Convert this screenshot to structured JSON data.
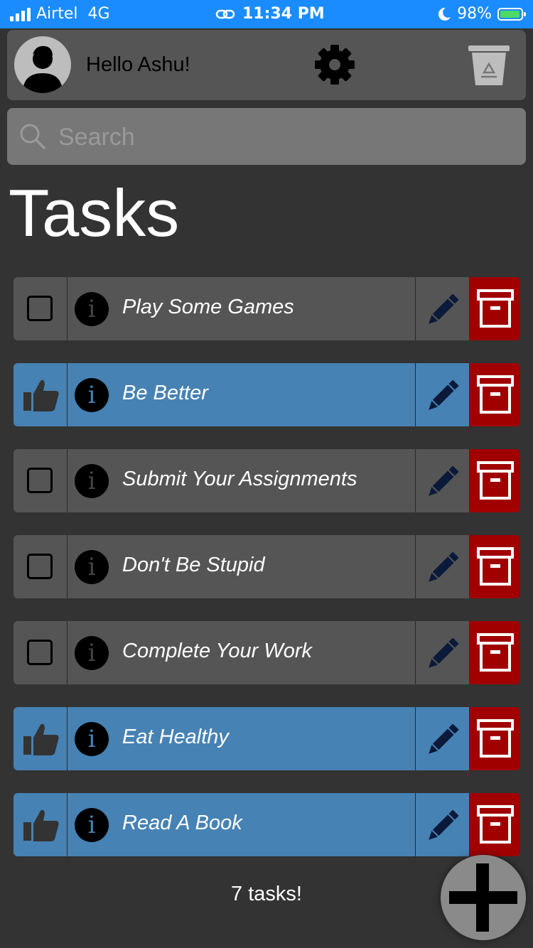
{
  "status_bar": {
    "carrier": "Airtel",
    "network": "4G",
    "time": "11:34 PM",
    "battery": "98%"
  },
  "header": {
    "greeting": "Hello Ashu!",
    "avatar_icon": "user-icon",
    "settings_icon": "gear-icon",
    "trash_icon": "recycle-bin-icon"
  },
  "search": {
    "placeholder": "Search"
  },
  "page_title": "Tasks",
  "colors": {
    "incomplete": "#555555",
    "completed": "#4682b4",
    "archive": "#a10000"
  },
  "tasks": [
    {
      "title": "Play Some Games",
      "completed": false
    },
    {
      "title": "Be Better",
      "completed": true
    },
    {
      "title": "Submit Your Assignments",
      "completed": false
    },
    {
      "title": "Don't Be Stupid",
      "completed": false
    },
    {
      "title": "Complete Your Work",
      "completed": false
    },
    {
      "title": "Eat Healthy",
      "completed": true
    },
    {
      "title": "Read A Book",
      "completed": true
    }
  ],
  "task_count": "7 tasks!",
  "add_button_icon": "plus-icon"
}
